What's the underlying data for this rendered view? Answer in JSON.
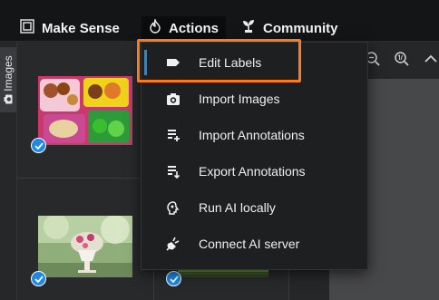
{
  "topbar": {
    "brand": {
      "icon": "square-frame-icon",
      "label": "Make Sense"
    },
    "nav": [
      {
        "icon": "flame-icon",
        "label": "Actions"
      },
      {
        "icon": "plant-icon",
        "label": "Community"
      }
    ]
  },
  "sidebar": {
    "tab_label": "Images",
    "tab_icon": "camera-icon"
  },
  "gallery": {
    "items": [
      {
        "name": "lunchbox-image",
        "checked": true
      },
      {
        "name": "flower-vase-image",
        "checked": true
      },
      {
        "name": "landscape-image",
        "checked": true
      }
    ]
  },
  "toolbar": {
    "icons": [
      "zoom-out-icon",
      "zoom-fit-icon",
      "collapse-icon"
    ]
  },
  "actions_menu": {
    "items": [
      {
        "icon": "label-tag-icon",
        "label": "Edit Labels",
        "active": true
      },
      {
        "icon": "camera-icon",
        "label": "Import Images"
      },
      {
        "icon": "playlist-add-icon",
        "label": "Import Annotations"
      },
      {
        "icon": "playlist-export-icon",
        "label": "Export Annotations"
      },
      {
        "icon": "ai-brain-icon",
        "label": "Run AI locally"
      },
      {
        "icon": "plug-icon",
        "label": "Connect AI server"
      }
    ]
  },
  "colors": {
    "accent": "#1e88e5",
    "highlight": "#ff7a1a",
    "menu_bg": "#1e1f21"
  }
}
